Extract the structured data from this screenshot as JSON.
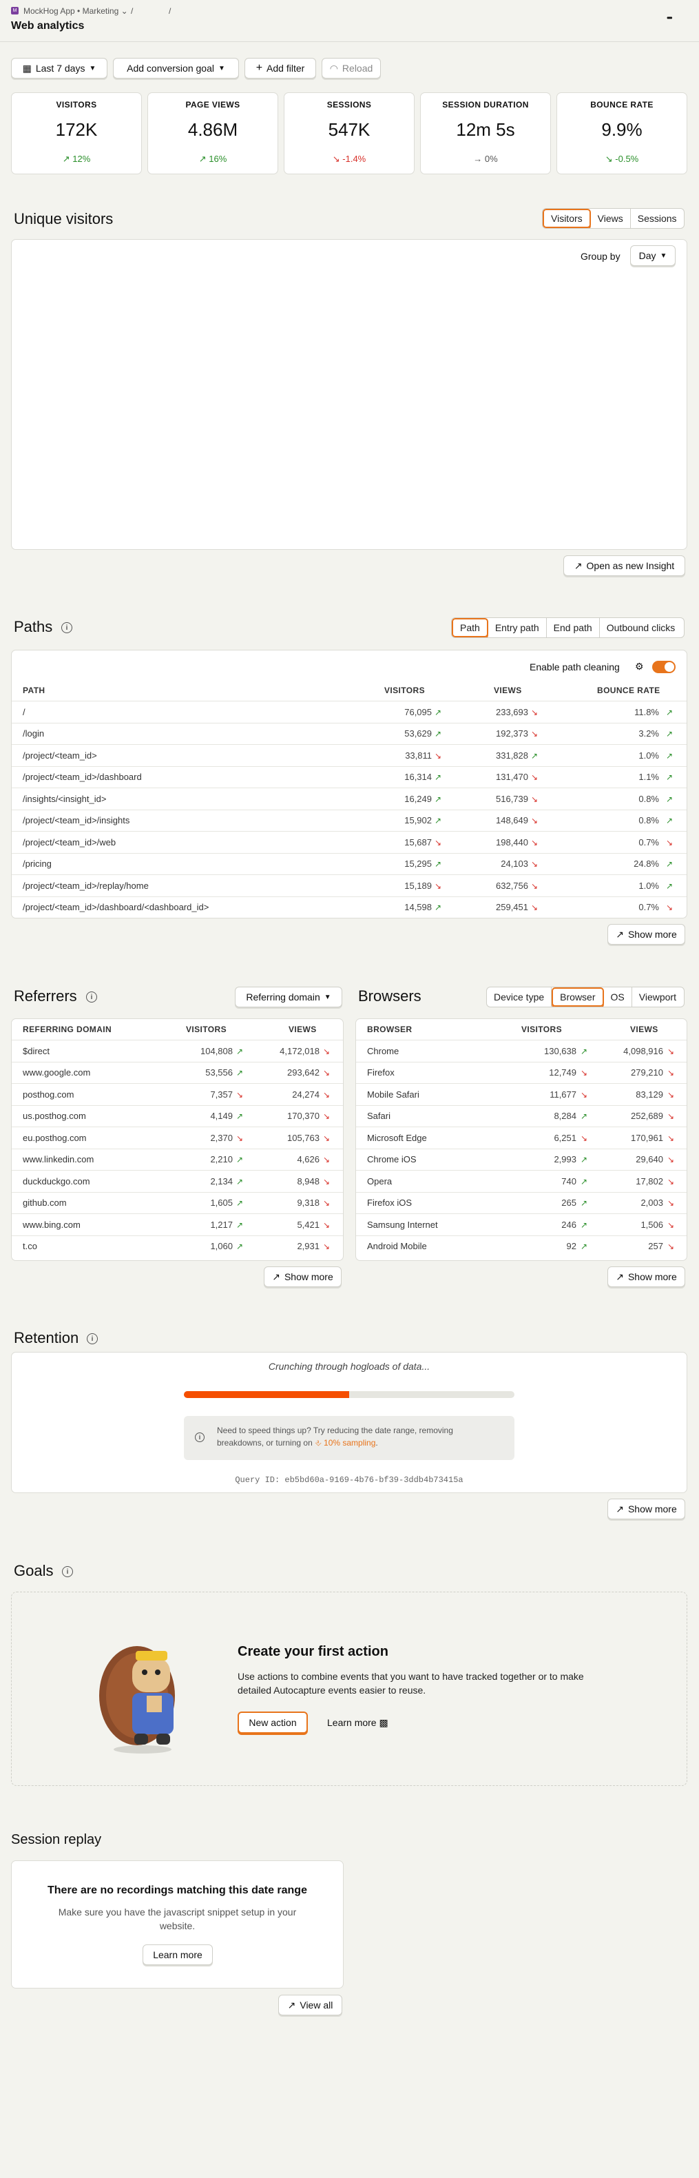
{
  "header": {
    "app_icon": "M",
    "breadcrumb_org": "MockHog App • Marketing",
    "breadcrumb_sep1": "/",
    "breadcrumb_sep2": "/",
    "title": "Web analytics",
    "more": "•••"
  },
  "filters": {
    "date": "Last 7 days",
    "conversion": "Add conversion goal",
    "add_filter": "Add filter",
    "reload": "Reload"
  },
  "stats": [
    {
      "label": "VISITORS",
      "value": "172K",
      "trend": "12%",
      "dir": "up"
    },
    {
      "label": "PAGE VIEWS",
      "value": "4.86M",
      "trend": "16%",
      "dir": "up"
    },
    {
      "label": "SESSIONS",
      "value": "547K",
      "trend": "-1.4%",
      "dir": "down"
    },
    {
      "label": "SESSION DURATION",
      "value": "12m 5s",
      "trend": "0%",
      "dir": "flat"
    },
    {
      "label": "BOUNCE RATE",
      "value": "9.9%",
      "trend": "-0.5%",
      "dir": "down-good"
    }
  ],
  "unique": {
    "title": "Unique visitors",
    "tabs": [
      "Visitors",
      "Views",
      "Sessions"
    ],
    "group_by": "Group by",
    "group_value": "Day",
    "open_insight": "Open as new Insight"
  },
  "paths": {
    "title": "Paths",
    "tabs": [
      "Path",
      "Entry path",
      "End path",
      "Outbound clicks"
    ],
    "clean_label": "Enable path cleaning",
    "cols": [
      "PATH",
      "VISITORS",
      "VIEWS",
      "BOUNCE RATE"
    ],
    "rows": [
      [
        "/",
        "76,095",
        "up",
        "233,693",
        "dn",
        "11.8%",
        "up"
      ],
      [
        "/login",
        "53,629",
        "up",
        "192,373",
        "dn",
        "3.2%",
        "up"
      ],
      [
        "/project/<team_id>",
        "33,811",
        "dn",
        "331,828",
        "up",
        "1.0%",
        "up"
      ],
      [
        "/project/<team_id>/dashboard",
        "16,314",
        "up",
        "131,470",
        "dn",
        "1.1%",
        "up"
      ],
      [
        "/insights/<insight_id>",
        "16,249",
        "up",
        "516,739",
        "dn",
        "0.8%",
        "up"
      ],
      [
        "/project/<team_id>/insights",
        "15,902",
        "up",
        "148,649",
        "dn",
        "0.8%",
        "up"
      ],
      [
        "/project/<team_id>/web",
        "15,687",
        "dn",
        "198,440",
        "dn",
        "0.7%",
        "dn"
      ],
      [
        "/pricing",
        "15,295",
        "up",
        "24,103",
        "dn",
        "24.8%",
        "up"
      ],
      [
        "/project/<team_id>/replay/home",
        "15,189",
        "dn",
        "632,756",
        "dn",
        "1.0%",
        "up"
      ],
      [
        "/project/<team_id>/dashboard/<dashboard_id>",
        "14,598",
        "up",
        "259,451",
        "dn",
        "0.7%",
        "dn"
      ]
    ],
    "show_more": "Show more"
  },
  "referrers": {
    "title": "Referrers",
    "dropdown": "Referring domain",
    "cols": [
      "REFERRING DOMAIN",
      "VISITORS",
      "VIEWS"
    ],
    "rows": [
      [
        "$direct",
        "104,808",
        "up",
        "4,172,018",
        "dn"
      ],
      [
        "www.google.com",
        "53,556",
        "up",
        "293,642",
        "dn"
      ],
      [
        "posthog.com",
        "7,357",
        "dn",
        "24,274",
        "dn"
      ],
      [
        "us.posthog.com",
        "4,149",
        "up",
        "170,370",
        "dn"
      ],
      [
        "eu.posthog.com",
        "2,370",
        "dn",
        "105,763",
        "dn"
      ],
      [
        "www.linkedin.com",
        "2,210",
        "up",
        "4,626",
        "dn"
      ],
      [
        "duckduckgo.com",
        "2,134",
        "up",
        "8,948",
        "dn"
      ],
      [
        "github.com",
        "1,605",
        "up",
        "9,318",
        "dn"
      ],
      [
        "www.bing.com",
        "1,217",
        "up",
        "5,421",
        "dn"
      ],
      [
        "t.co",
        "1,060",
        "up",
        "2,931",
        "dn"
      ]
    ],
    "show_more": "Show more"
  },
  "browsers": {
    "title": "Browsers",
    "tabs": [
      "Device type",
      "Browser",
      "OS",
      "Viewport"
    ],
    "cols": [
      "BROWSER",
      "VISITORS",
      "VIEWS"
    ],
    "rows": [
      [
        "Chrome",
        "130,638",
        "up",
        "4,098,916",
        "dn"
      ],
      [
        "Firefox",
        "12,749",
        "dn",
        "279,210",
        "dn"
      ],
      [
        "Mobile Safari",
        "11,677",
        "dn",
        "83,129",
        "dn"
      ],
      [
        "Safari",
        "8,284",
        "up",
        "252,689",
        "dn"
      ],
      [
        "Microsoft Edge",
        "6,251",
        "dn",
        "170,961",
        "dn"
      ],
      [
        "Chrome iOS",
        "2,993",
        "up",
        "29,640",
        "dn"
      ],
      [
        "Opera",
        "740",
        "up",
        "17,802",
        "dn"
      ],
      [
        "Firefox iOS",
        "265",
        "up",
        "2,003",
        "dn"
      ],
      [
        "Samsung Internet",
        "246",
        "up",
        "1,506",
        "dn"
      ],
      [
        "Android Mobile",
        "92",
        "up",
        "257",
        "dn"
      ]
    ],
    "show_more": "Show more"
  },
  "retention": {
    "title": "Retention",
    "loading": "Crunching through hogloads of data...",
    "progress": 0.5,
    "tip1": "Need to speed things up? Try reducing the date range, removing",
    "tip2": "breakdowns, or turning on",
    "tip_link": "10% sampling",
    "tip_end": ".",
    "query": "Query ID: eb5bd60a-9169-4b76-bf39-3ddb4b73415a",
    "show_more": "Show more"
  },
  "goals": {
    "title": "Goals",
    "heading": "Create your first action",
    "desc1": "Use actions to combine events that you want to have tracked together or to make",
    "desc2": "detailed Autocapture events easier to reuse.",
    "new_action": "New action",
    "learn_more": "Learn more"
  },
  "replay": {
    "title": "Session replay",
    "heading": "There are no recordings matching this date range",
    "desc1": "Make sure you have the javascript snippet setup in your",
    "desc2": "website.",
    "learn_more": "Learn more",
    "view_all": "View all"
  },
  "colors": {
    "accent": "#e8741b",
    "up": "#2a8f2a",
    "down": "#d8322b",
    "bg": "#f3f3ee"
  }
}
